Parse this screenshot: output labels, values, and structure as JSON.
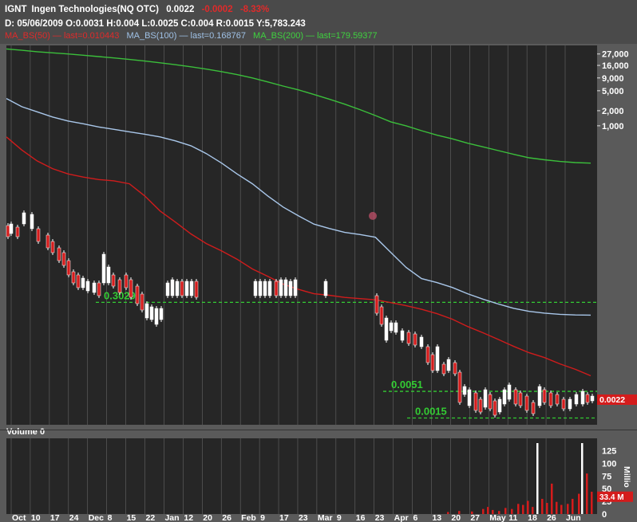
{
  "header": {
    "symbol": "IGNT",
    "name": "Ingen Technologies(NQ OTC)",
    "price": "0.0022",
    "change": "-0.0002",
    "change_pct": "-8.33%",
    "ohlc_line": "D: 05/06/2009 O:0.0031 H:0.004 L:0.0025 C:0.004 R:0.0015 Y:5,783.243",
    "ma50_text": "MA_BS(50) — last=0.010443",
    "ma100_text": "MA_BS(100) — last=0.168767",
    "ma200_text": "MA_BS(200) — last=179.59377"
  },
  "colors": {
    "background": "#5a5a5a",
    "plot_bg": "#262626",
    "grid": "#9a9a9a",
    "ma50": "#d01c1c",
    "ma100": "#a9c7ea",
    "ma200": "#3bbf3b",
    "level": "#33cc33",
    "down_candle": "#d41c1c",
    "up_candle": "#ffffff"
  },
  "chart_data": {
    "type": "line",
    "price_axis": {
      "scale": "log",
      "tick_labels": [
        "27,000",
        "16,000",
        "9,000",
        "5,000",
        "2,000",
        "1,000"
      ],
      "current_price_label": "0.0022"
    },
    "x_tick_labels": [
      "Oct",
      "10",
      "17",
      "24",
      "Dec",
      "8",
      "15",
      "22",
      "Jan",
      "12",
      "20",
      "26",
      "Feb",
      "9",
      "17",
      "23",
      "Mar",
      "9",
      "16",
      "23",
      "Apr",
      "6",
      "13",
      "20",
      "27",
      "May",
      "11",
      "18",
      "26",
      "Jun"
    ],
    "levels": [
      {
        "label": "0.3029",
        "value": 0.3029
      },
      {
        "label": "0.0051",
        "value": 0.0051
      },
      {
        "label": "0.0015",
        "value": 0.0015
      }
    ],
    "series": [
      {
        "name": "MA_BS(200)",
        "last": 179.59377,
        "values": [
          34000,
          32000,
          30000,
          28500,
          27000,
          25500,
          24000,
          22500,
          21000,
          19500,
          18000,
          16500,
          15000,
          13500,
          12000,
          10500,
          9000,
          7500,
          6200,
          5200,
          4200,
          3400,
          2700,
          2100,
          1600,
          1200,
          1000,
          800,
          650,
          550,
          450,
          380,
          320,
          270,
          230,
          210,
          195,
          185,
          180
        ]
      },
      {
        "name": "MA_BS(100)",
        "last": 0.168767,
        "values": [
          3500,
          2400,
          1900,
          1500,
          1250,
          1100,
          950,
          850,
          760,
          680,
          600,
          500,
          400,
          280,
          180,
          110,
          70,
          40,
          24,
          16,
          11,
          9,
          7.5,
          6.8,
          6,
          3,
          1.5,
          0.9,
          0.75,
          0.6,
          0.45,
          0.35,
          0.28,
          0.23,
          0.2,
          0.185,
          0.175,
          0.17,
          0.168767
        ]
      },
      {
        "name": "MA_BS(50)",
        "last": 0.010443,
        "values": [
          600,
          330,
          200,
          140,
          110,
          95,
          85,
          80,
          70,
          40,
          20,
          12,
          7,
          4.5,
          3.2,
          2.2,
          1.4,
          1,
          0.7,
          0.55,
          0.45,
          0.42,
          0.38,
          0.36,
          0.34,
          0.3,
          0.26,
          0.22,
          0.18,
          0.14,
          0.1,
          0.075,
          0.055,
          0.04,
          0.03,
          0.024,
          0.018,
          0.014,
          0.010443
        ]
      }
    ]
  },
  "volume": {
    "title": "Volume 0",
    "unit_label": "Millio",
    "tick_labels": [
      "125",
      "100",
      "75",
      "50",
      "25",
      "0"
    ],
    "current_label": "33.4 M"
  }
}
